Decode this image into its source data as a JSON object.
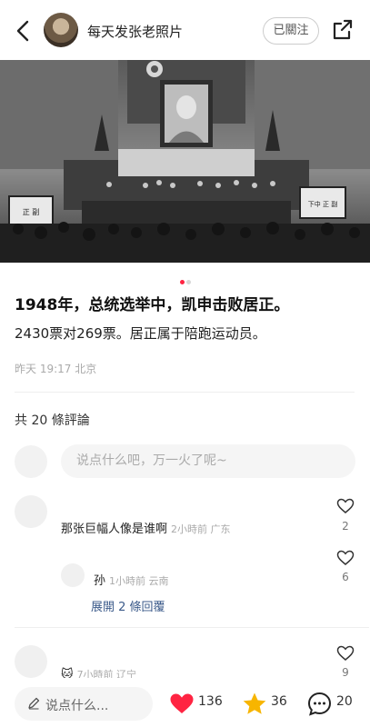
{
  "header": {
    "author_name": "每天发张老照片",
    "follow_label": "已關注"
  },
  "photo": {
    "sign_left": "正 副",
    "sign_right": "下中 正 副"
  },
  "carousel": {
    "count": 2,
    "active": 1
  },
  "post": {
    "title": "1948年，总统选举中，凯申击败居正。",
    "desc": "2430票对269票。居正属于陪跑运动员。",
    "time": "昨天 19:17 北京"
  },
  "comments": {
    "count_label": "共 20 條評論",
    "input_placeholder": "说点什么吧，万一火了呢~",
    "items": [
      {
        "text": "那张巨幅人像是谁啊",
        "meta": "2小時前 广东",
        "likes": "2"
      },
      {
        "text": "孙",
        "meta": "1小時前 云南",
        "likes": "6"
      },
      {
        "text": "",
        "meta": "7小時前 辽宁",
        "likes": "9"
      }
    ],
    "expand_label": "展開 2 條回覆"
  },
  "bottom": {
    "say_placeholder": "说点什么...",
    "likes": "136",
    "stars": "36",
    "comments": "20"
  },
  "colors": {
    "accent": "#ff2442",
    "star": "#f7b500",
    "link": "#3b5a8a"
  }
}
